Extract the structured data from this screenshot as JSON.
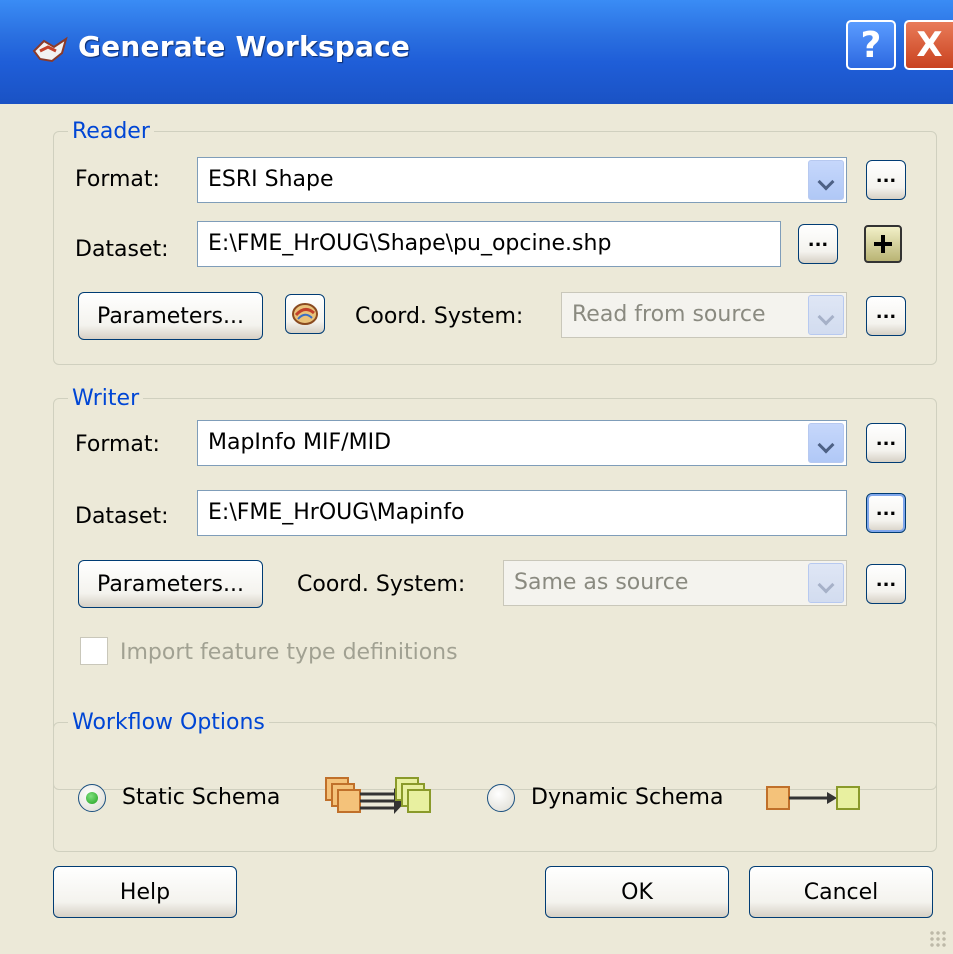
{
  "window": {
    "title": "Generate Workspace",
    "help_glyph": "?",
    "close_glyph": "X"
  },
  "reader": {
    "legend": "Reader",
    "format_label": "Format:",
    "format_value": "ESRI Shape",
    "dataset_label": "Dataset:",
    "dataset_value": "E:\\FME_HrOUG\\Shape\\pu_opcine.shp",
    "parameters_label": "Parameters...",
    "coord_label": "Coord. System:",
    "coord_value": "Read from source"
  },
  "writer": {
    "legend": "Writer",
    "format_label": "Format:",
    "format_value": "MapInfo MIF/MID",
    "dataset_label": "Dataset:",
    "dataset_value": "E:\\FME_HrOUG\\Mapinfo",
    "parameters_label": "Parameters...",
    "coord_label": "Coord. System:",
    "coord_value": "Same as source",
    "import_label": "Import feature type definitions",
    "import_checked": false
  },
  "workflow": {
    "legend": "Workflow Options",
    "static_label": "Static Schema",
    "dynamic_label": "Dynamic Schema",
    "selected": "Static Schema"
  },
  "buttons": {
    "help": "Help",
    "ok": "OK",
    "cancel": "Cancel",
    "browse": "..."
  },
  "icons": [
    "app-icon",
    "help-icon",
    "close-icon",
    "combo-arrow-icon",
    "add-icon",
    "coord-picker-icon",
    "static-schema-icon",
    "dynamic-schema-icon"
  ]
}
